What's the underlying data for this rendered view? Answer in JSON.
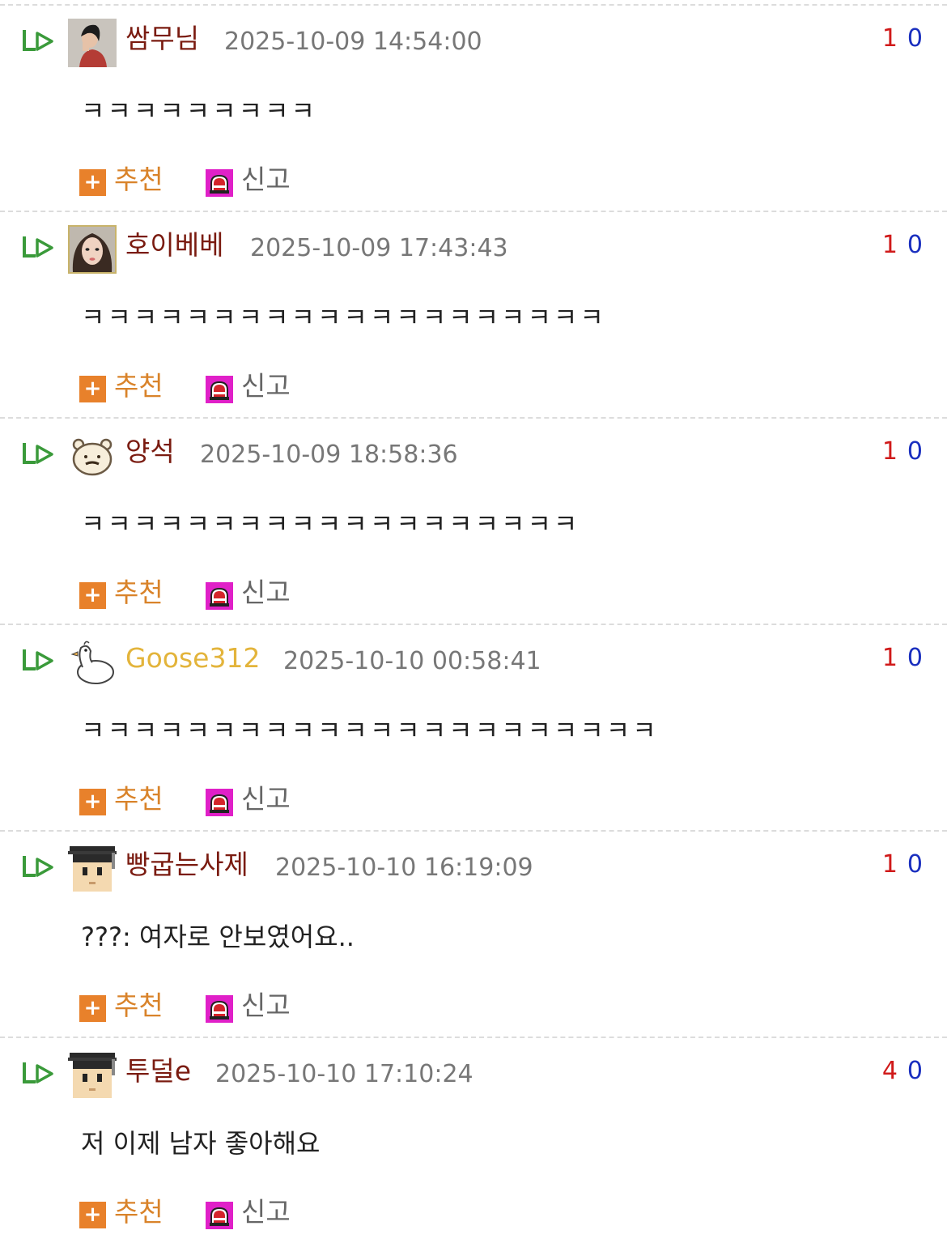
{
  "labels": {
    "recommend": "추천",
    "report": "신고"
  },
  "comments": [
    {
      "author": "쌈무님",
      "date": "2025-10-09 14:54:00",
      "up": "1",
      "down": "0",
      "body": "ㅋㅋㅋㅋㅋㅋㅋㅋㅋ"
    },
    {
      "author": "호이베베",
      "date": "2025-10-09 17:43:43",
      "up": "1",
      "down": "0",
      "body": "ㅋㅋㅋㅋㅋㅋㅋㅋㅋㅋㅋㅋㅋㅋㅋㅋㅋㅋㅋㅋ"
    },
    {
      "author": "양석",
      "date": "2025-10-09 18:58:36",
      "up": "1",
      "down": "0",
      "body": "ㅋㅋㅋㅋㅋㅋㅋㅋㅋㅋㅋㅋㅋㅋㅋㅋㅋㅋㅋ"
    },
    {
      "author": "Goose312",
      "date": "2025-10-10 00:58:41",
      "up": "1",
      "down": "0",
      "body": "ㅋㅋㅋㅋㅋㅋㅋㅋㅋㅋㅋㅋㅋㅋㅋㅋㅋㅋㅋㅋㅋㅋ"
    },
    {
      "author": "빵굽는사제",
      "date": "2025-10-10 16:19:09",
      "up": "1",
      "down": "0",
      "body": "???: 여자로 안보였어요.."
    },
    {
      "author": "투덜e",
      "date": "2025-10-10 17:10:24",
      "up": "4",
      "down": "0",
      "body": "저 이제 남자 좋아해요"
    }
  ],
  "colors": {
    "author": "#7a1b10",
    "author_special": "#e3b43b",
    "date": "#777777",
    "vote_up": "#d01a1a",
    "vote_down": "#1a2fbf",
    "recommend_icon": "#e8812b",
    "recommend_text": "#d9832a",
    "report_icon": "#e020c8",
    "reply_arrow": "#3a9a3a"
  },
  "icons": {
    "reply": "reply-arrow-icon",
    "recommend": "plus-icon",
    "report": "siren-icon"
  }
}
